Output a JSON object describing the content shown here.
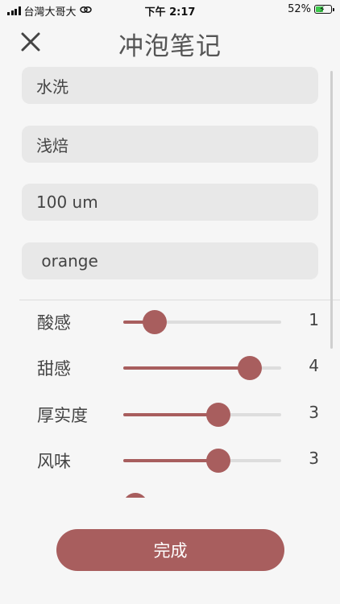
{
  "status_bar": {
    "carrier": "台灣大哥大",
    "time": "下午 2:17",
    "battery_percent": "52%",
    "battery_level": 0.52,
    "battery_color": "#3cc94b",
    "icons": [
      "signal-icon",
      "link-icon",
      "battery-charging-icon"
    ]
  },
  "header": {
    "title": "冲泡笔记",
    "close_icon": "close-icon"
  },
  "fields": [
    {
      "value": "水洗"
    },
    {
      "value": "浅焙"
    },
    {
      "value": "100 um"
    },
    {
      "value": " orange"
    }
  ],
  "ratings": {
    "min": 0,
    "max": 5,
    "items": [
      {
        "label": "酸感",
        "value": 1,
        "display": "1"
      },
      {
        "label": "甜感",
        "value": 4,
        "display": "4"
      },
      {
        "label": "厚实度",
        "value": 3,
        "display": "3"
      },
      {
        "label": "风味",
        "value": 3,
        "display": "3"
      }
    ]
  },
  "done_button": {
    "label": "完成"
  },
  "colors": {
    "accent": "#a85e5e",
    "background": "#f6f6f6",
    "field_bg": "#e8e8e8",
    "track": "#dddddd"
  }
}
